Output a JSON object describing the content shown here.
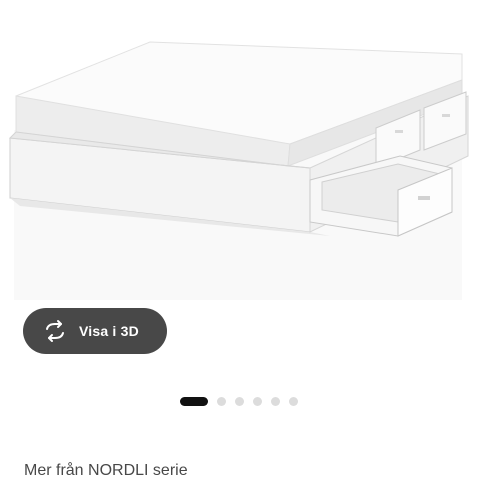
{
  "product": {
    "image_alt": "NORDLI bed frame with storage"
  },
  "view_3d": {
    "label": "Visa i 3D",
    "icon": "rotate-3d-icon"
  },
  "carousel": {
    "total": 6,
    "active_index": 0
  },
  "series_link": {
    "label": "Mer från NORDLI serie"
  },
  "colors": {
    "button_bg": "#484848",
    "dot_active": "#111111",
    "dot_inactive": "#dcdcdc"
  }
}
